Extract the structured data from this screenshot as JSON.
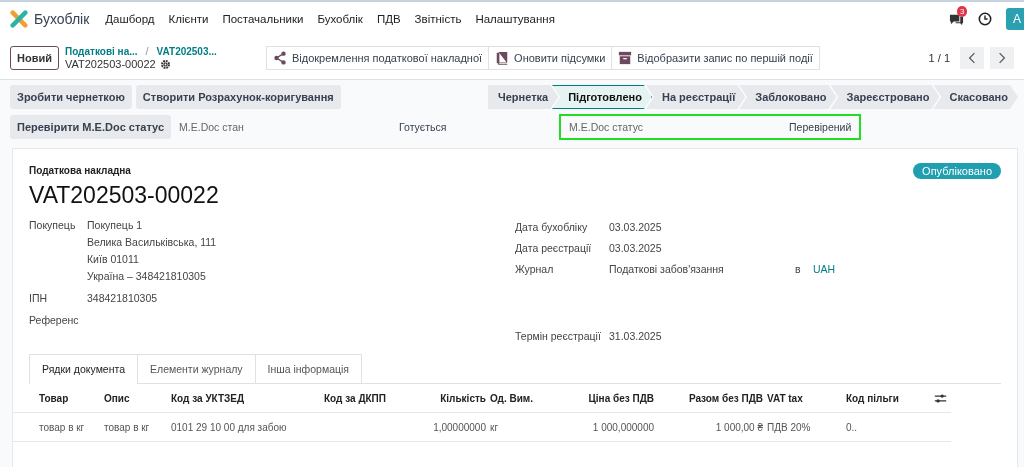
{
  "navbar": {
    "app_name": "Бухоблік",
    "menu": [
      "Дашборд",
      "Клієнти",
      "Постачальники",
      "Бухоблік",
      "ПДВ",
      "Звітність",
      "Налаштування"
    ],
    "message_count": "3",
    "avatar": "A"
  },
  "control_panel": {
    "new_button": "Новий",
    "breadcrumbs": [
      "Податкові на...",
      "VAT202503..."
    ],
    "breadcrumb_separator": "/",
    "record_name": "VAT202503-00022",
    "actions": [
      "Відокремлення податкової накладної",
      "Оновити підсумки",
      "Відобразити запис по першій події"
    ],
    "pager": "1 / 1"
  },
  "header_buttons": [
    "Зробити чернеткою",
    "Створити Розрахунок-коригування"
  ],
  "stages": [
    {
      "label": "Чернетка",
      "selected": false
    },
    {
      "label": "Підготовлено",
      "selected": true
    },
    {
      "label": "На реєстрації",
      "selected": false
    },
    {
      "label": "Заблоковано",
      "selected": false
    },
    {
      "label": "Зареєстровано",
      "selected": false
    },
    {
      "label": "Скасовано",
      "selected": false
    }
  ],
  "medoc_row": {
    "button": "Перевірити M.E.Doc статус",
    "state_label": "M.E.Doc стан",
    "state_value": "Готується",
    "status_label": "M.E.Doc статус",
    "status_value": "Перевірений"
  },
  "sheet": {
    "doc_type": "Податкова накладна",
    "title": "VAT202503-00022",
    "badge": "Опубліковано",
    "left_fields": [
      {
        "label": "Покупець",
        "lines": [
          "Покупець 1",
          "Велика Васильківська, 111",
          "Київ 01011",
          "Україна – 348421810305"
        ]
      },
      {
        "label": "ІПН",
        "lines": [
          "348421810305"
        ]
      },
      {
        "label": "Референс"
      }
    ],
    "right_fields": [
      {
        "label": "Дата бухобліку",
        "value": "03.03.2025"
      },
      {
        "label": "Дата реєстрації",
        "value": "03.03.2025"
      },
      {
        "label": "Журнал",
        "value": "Податкові забов'язання",
        "joiner": "в",
        "currency": "UAH"
      },
      {
        "label": "Термін реєстрації",
        "value": "31.03.2025"
      }
    ],
    "tabs": [
      {
        "label": "Рядки документа",
        "selected": true
      },
      {
        "label": "Елементи журналу",
        "selected": false
      },
      {
        "label": "Інша інформація",
        "selected": false
      }
    ],
    "table": {
      "columns": [
        "Товар",
        "Опис",
        "Код за УКТЗЕД",
        "Код за ДКПП",
        "Кількість",
        "Од. Вим.",
        "Ціна без ПДВ",
        "Разом без ПДВ",
        "VAT tax",
        "Код пільги"
      ],
      "rows": [
        [
          "товар в кг",
          "товар в кг",
          "0101 29 10 00 для забою",
          "",
          "1,00000000",
          "кг",
          "1 000,000000",
          "1 000,00 ₴",
          "ПДВ 20%",
          "0.."
        ]
      ]
    }
  }
}
